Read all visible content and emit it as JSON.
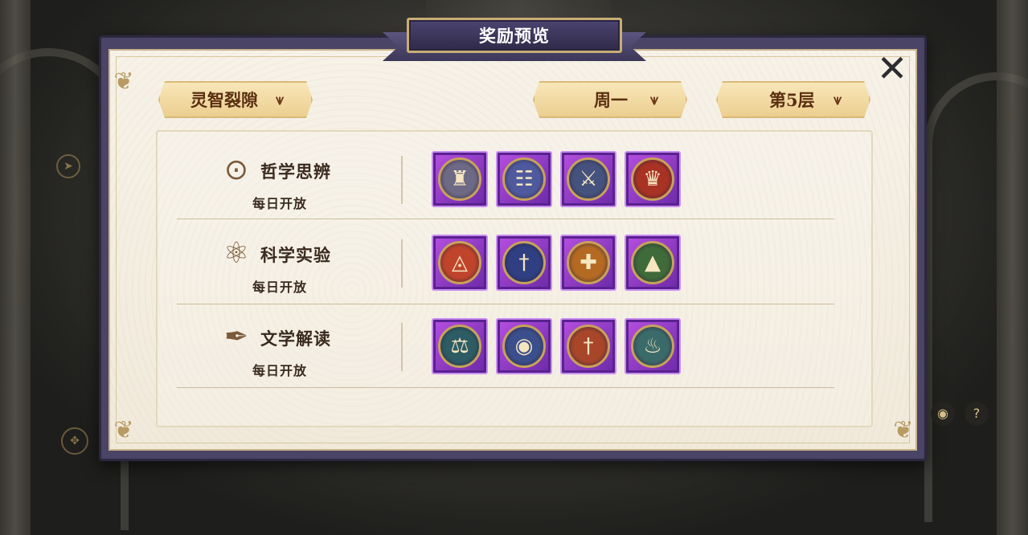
{
  "title": "奖励预览",
  "close_icon": "close-icon",
  "dropdowns": {
    "dungeon": "灵智裂隙",
    "day": "周一",
    "floor": "第5层",
    "arrow": "⩛"
  },
  "categories": [
    {
      "name": "哲学思辨",
      "availability": "每日开放",
      "icon": "⊙",
      "icon_name": "eye-icon",
      "rewards": [
        {
          "icon_name": "statue-medal-icon",
          "glyph": "♜",
          "color": "#6e6a86"
        },
        {
          "icon_name": "tablet-medal-icon",
          "glyph": "☷",
          "color": "#4f5a9e"
        },
        {
          "icon_name": "axe-medal-icon",
          "glyph": "⚔",
          "color": "#45527e"
        },
        {
          "icon_name": "chalice-medal-icon",
          "glyph": "♛",
          "color": "#a83224"
        }
      ]
    },
    {
      "name": "科学实验",
      "availability": "每日开放",
      "icon": "⚛",
      "icon_name": "atom-icon",
      "rewards": [
        {
          "icon_name": "eye-triangle-medal-icon",
          "glyph": "◬",
          "color": "#c0442c"
        },
        {
          "icon_name": "dagger-medal-icon",
          "glyph": "†",
          "color": "#2f3f82"
        },
        {
          "icon_name": "crossbow-medal-icon",
          "glyph": "✚",
          "color": "#b46a22"
        },
        {
          "icon_name": "spearhead-medal-icon",
          "glyph": "▲",
          "color": "#3f6a3a"
        }
      ]
    },
    {
      "name": "文学解读",
      "availability": "每日开放",
      "icon": "✒",
      "icon_name": "quill-icon",
      "rewards": [
        {
          "icon_name": "scale-medal-icon",
          "glyph": "⚖",
          "color": "#2d5c64"
        },
        {
          "icon_name": "crystal-ball-medal-icon",
          "glyph": "◉",
          "color": "#3a4f8c"
        },
        {
          "icon_name": "sword-medal-icon",
          "glyph": "†",
          "color": "#a8462a"
        },
        {
          "icon_name": "lamp-medal-icon",
          "glyph": "♨",
          "color": "#3b6a6a"
        }
      ]
    }
  ],
  "background": {
    "left_emblem_icon": "emblem-icon",
    "right_eye_icon": "eye-icon",
    "help_label": "?"
  }
}
